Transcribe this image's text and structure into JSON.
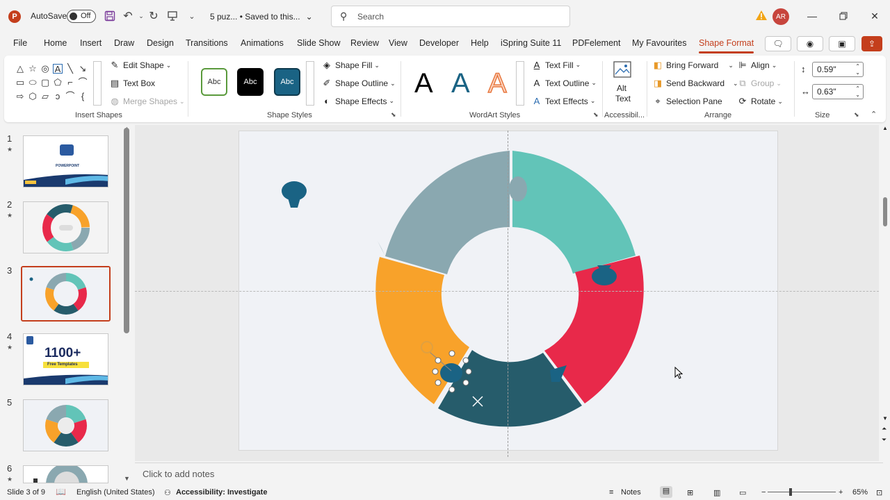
{
  "titlebar": {
    "app_logo": "P",
    "autosave_label": "AutoSave",
    "autosave_state": "Off",
    "doc_title": "5 puz...  •  Saved to this...",
    "search_placeholder": "Search",
    "avatar_initials": "AR",
    "icons": [
      "save-icon",
      "undo-icon",
      "redo-icon",
      "present-icon",
      "search-icon",
      "warning-icon",
      "minimize-icon",
      "restore-icon",
      "close-icon"
    ]
  },
  "tabs": [
    "File",
    "Home",
    "Insert",
    "Draw",
    "Design",
    "Transitions",
    "Animations",
    "Slide Show",
    "Review",
    "View",
    "Developer",
    "Help",
    "iSpring Suite 11",
    "PDFelement",
    "My Favourites",
    "Shape Format"
  ],
  "active_tab": "Shape Format",
  "ribbon": {
    "insert_shapes": {
      "label": "Insert Shapes",
      "edit_shape": "Edit Shape",
      "text_box": "Text Box",
      "merge_shapes": "Merge Shapes"
    },
    "shape_styles": {
      "label": "Shape Styles",
      "presets": [
        "Abc",
        "Abc",
        "Abc"
      ],
      "shape_fill": "Shape Fill",
      "shape_outline": "Shape Outline",
      "shape_effects": "Shape Effects"
    },
    "wordart": {
      "label": "WordArt Styles",
      "letters": [
        "A",
        "A",
        "A"
      ],
      "text_fill": "Text Fill",
      "text_outline": "Text Outline",
      "text_effects": "Text Effects"
    },
    "accessibility": {
      "label": "Accessibil...",
      "alt_text_line1": "Alt",
      "alt_text_line2": "Text"
    },
    "arrange": {
      "label": "Arrange",
      "bring_forward": "Bring Forward",
      "send_backward": "Send Backward",
      "selection_pane": "Selection Pane",
      "align": "Align",
      "group": "Group",
      "rotate": "Rotate"
    },
    "size": {
      "label": "Size",
      "height": "0.59\"",
      "width": "0.63\""
    }
  },
  "slides": [
    {
      "num": "1",
      "star": "★"
    },
    {
      "num": "2",
      "star": "★"
    },
    {
      "num": "3",
      "star": ""
    },
    {
      "num": "4",
      "star": "★"
    },
    {
      "num": "5",
      "star": ""
    },
    {
      "num": "6",
      "star": "★"
    }
  ],
  "thumb_text": {
    "s1_title": "POWERPOINT",
    "s4_big": "1100+",
    "s4_small": "Free Templates"
  },
  "colors": {
    "accent": "#c43e1c",
    "gray_segment": "#8aa8b0",
    "teal_segment": "#62c4b8",
    "red_segment": "#e8294a",
    "orange_segment": "#f8a22a",
    "dark_segment": "#265c6b",
    "piece_blue": "#1a6384"
  },
  "notes_placeholder": "Click to add notes",
  "status": {
    "slide_info": "Slide 3 of 9",
    "language": "English (United States)",
    "accessibility": "Accessibility: Investigate",
    "notes": "Notes",
    "zoom": "65%"
  }
}
